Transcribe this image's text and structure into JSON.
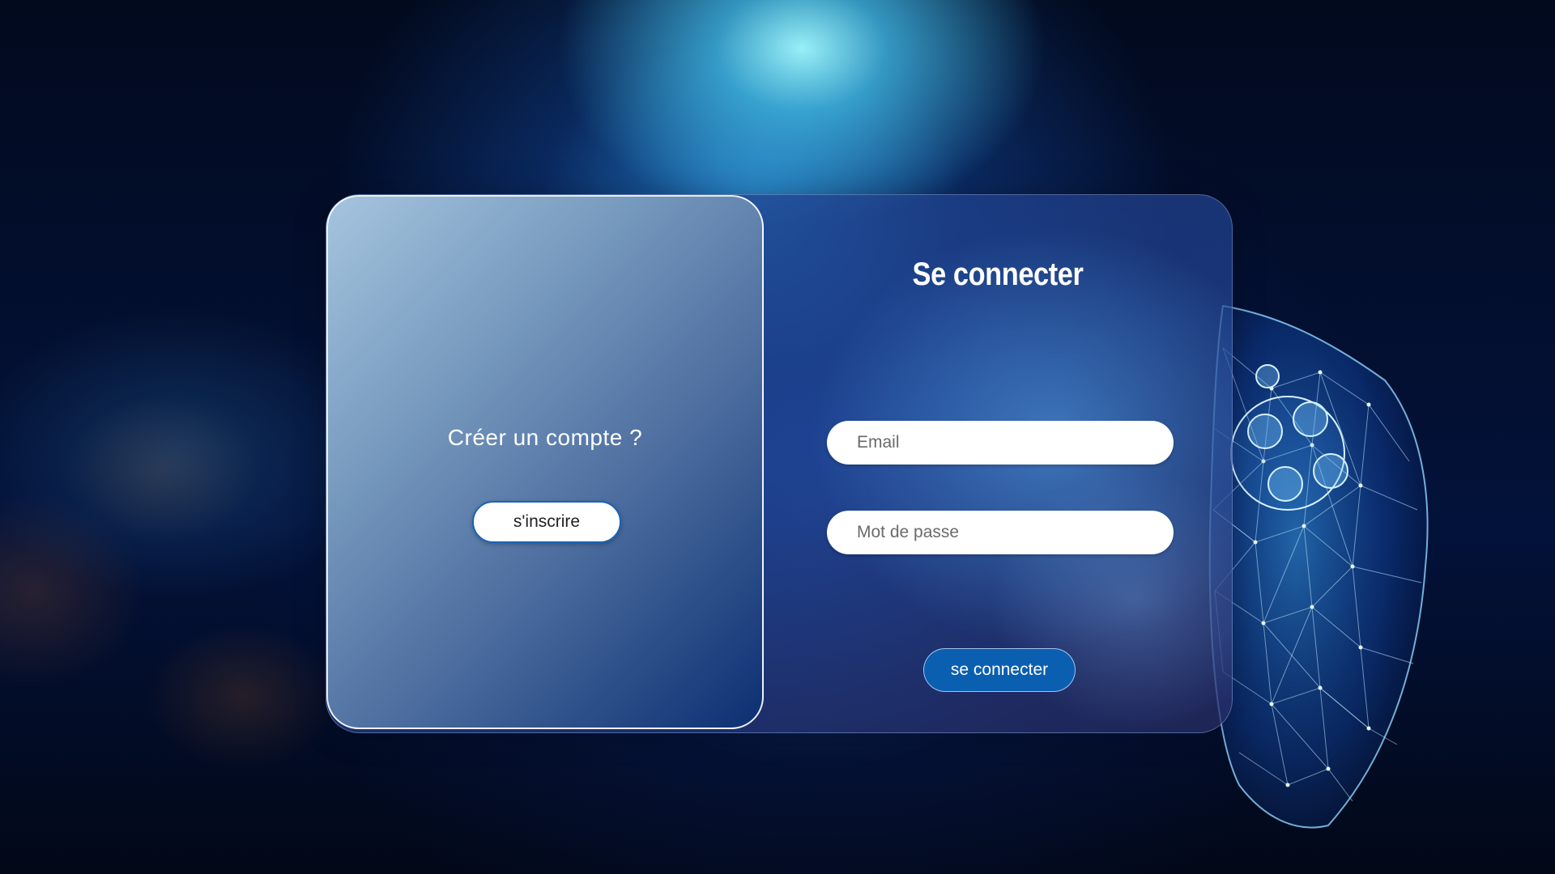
{
  "signup": {
    "question": "Créer un compte ?",
    "button_label": "s'inscrire"
  },
  "login": {
    "title": "Se connecter",
    "email_placeholder": "Email",
    "email_value": "",
    "password_placeholder": "Mot de passe",
    "password_value": "",
    "button_label": "se connecter"
  },
  "decoration": {
    "background_image": "glowing-game-controller",
    "accent_color": "#0b5fb0",
    "signup_gradient_end": "#0c2f72"
  }
}
